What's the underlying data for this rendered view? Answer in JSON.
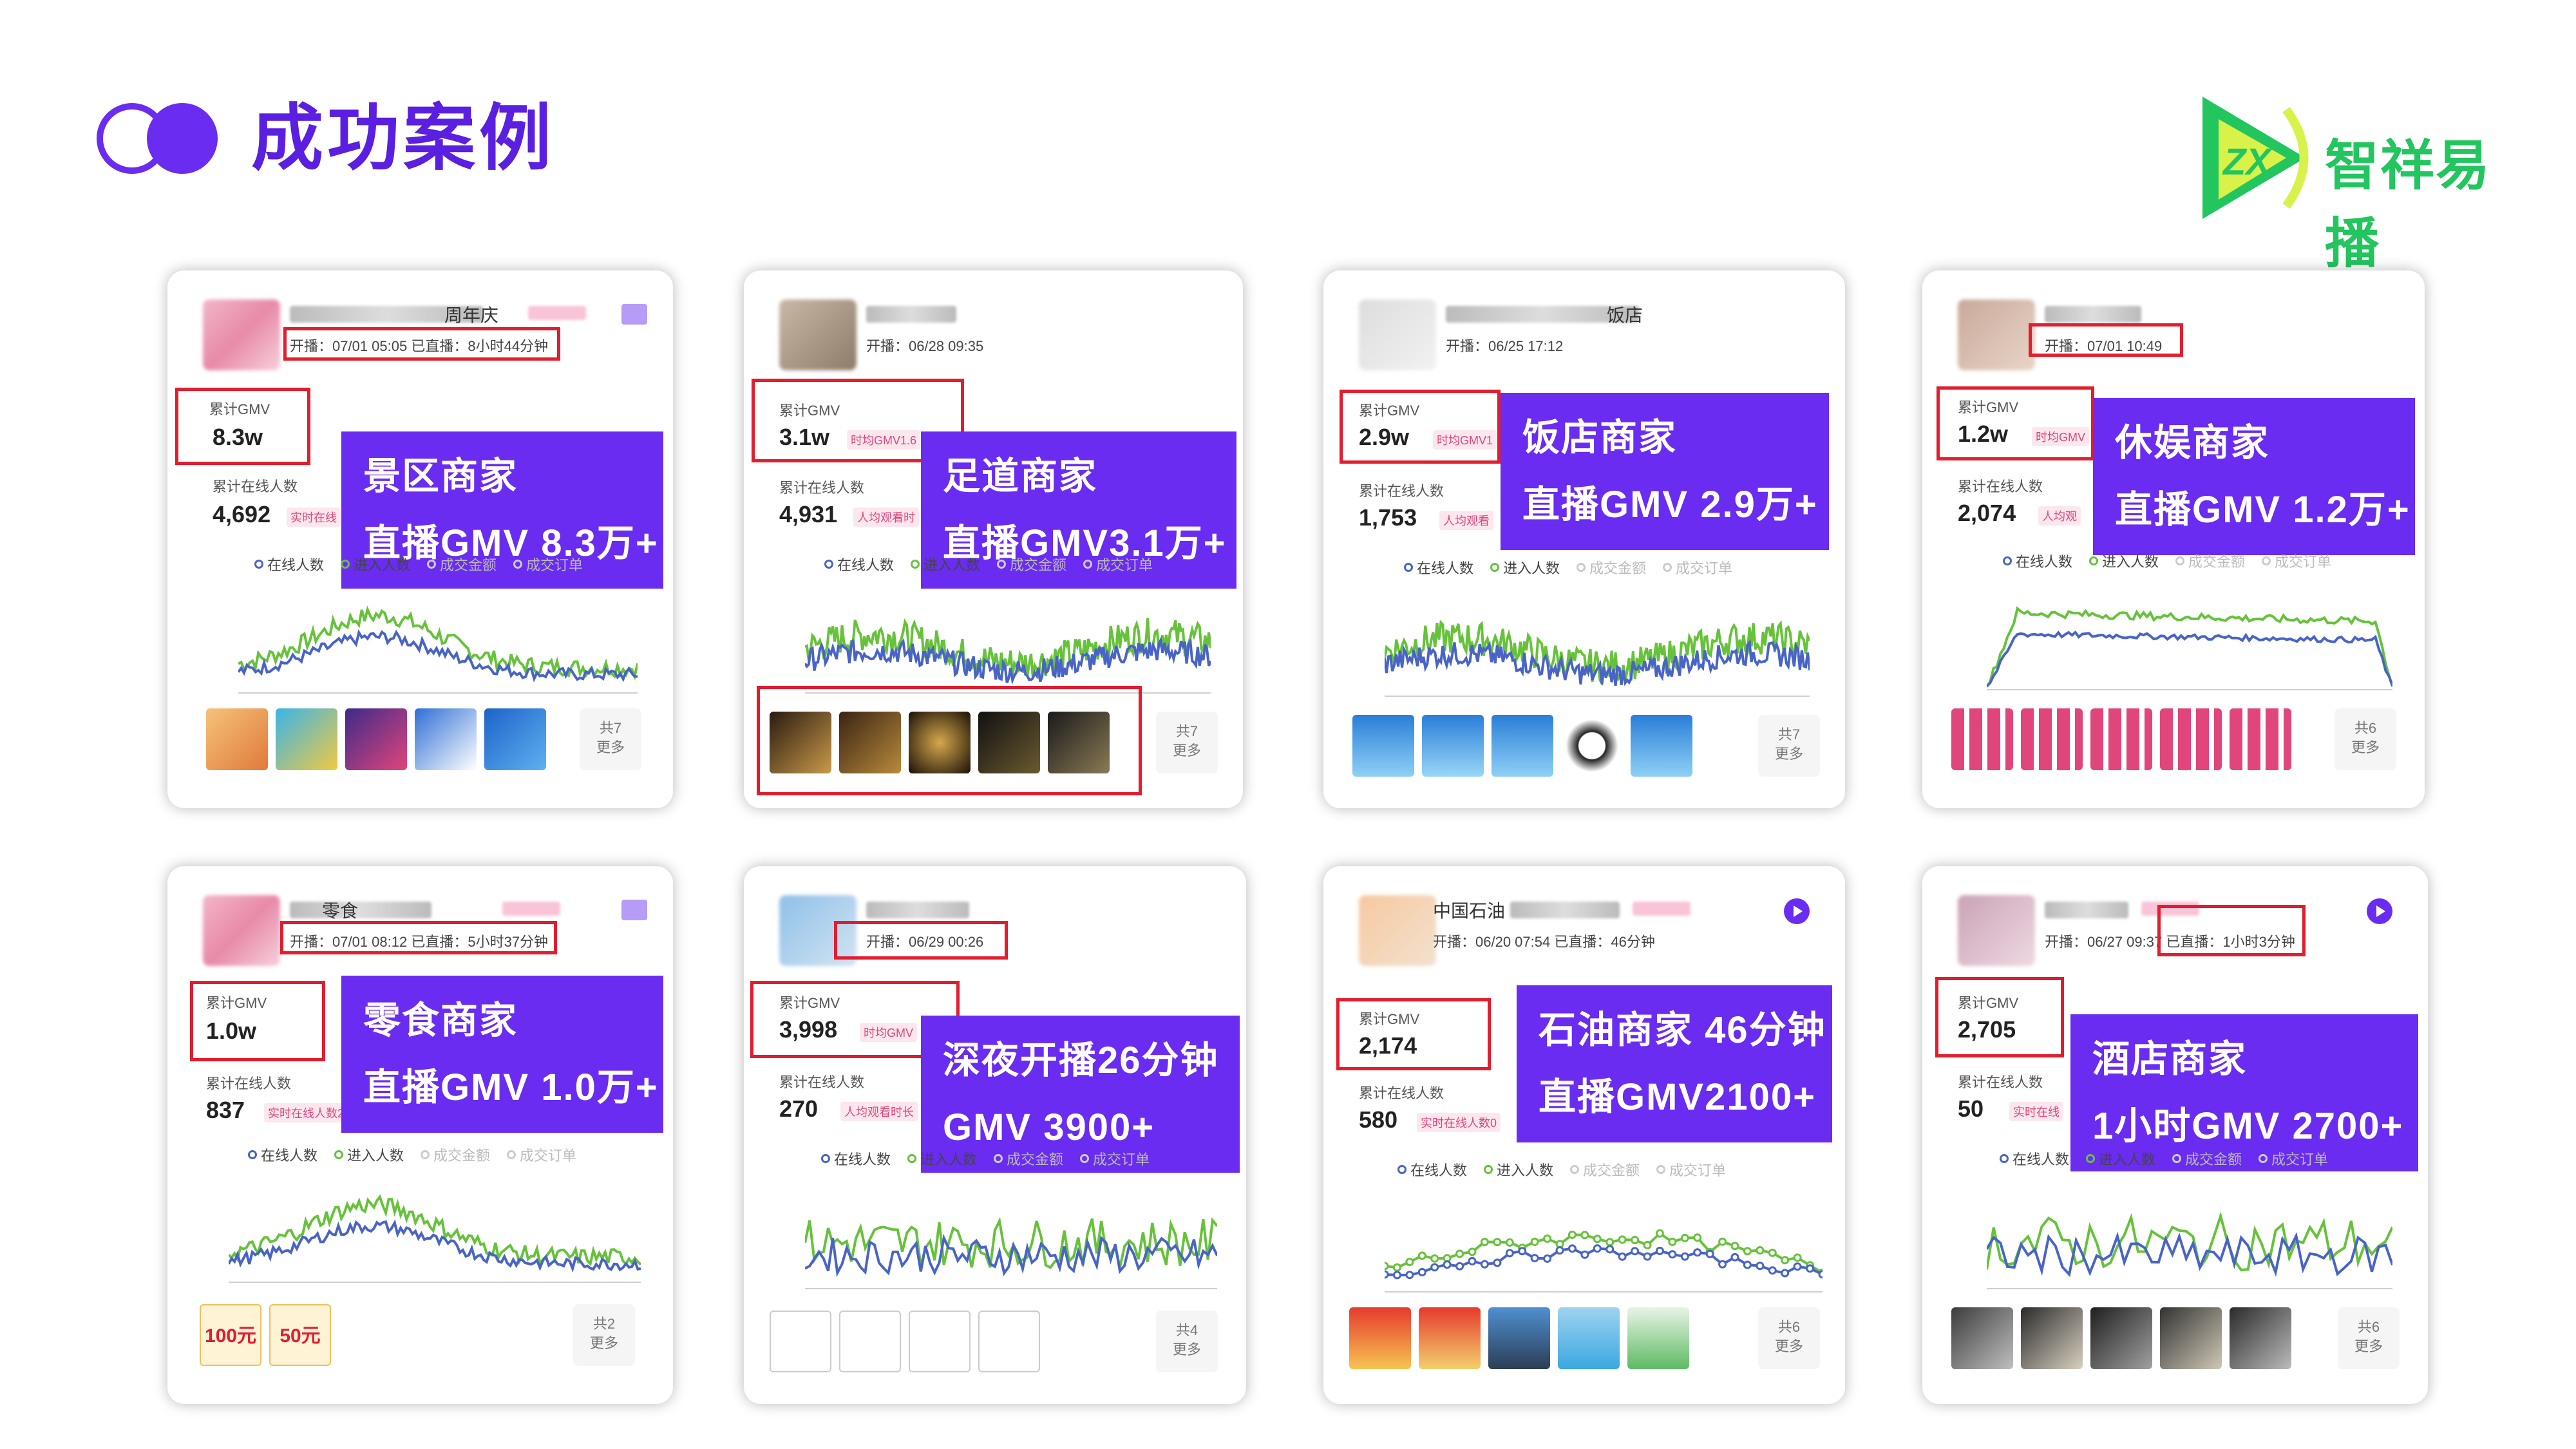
{
  "page": {
    "title": "成功案例"
  },
  "logo": {
    "mark_letters": "ZX",
    "text": "智祥易播"
  },
  "labels": {
    "start": "开播：",
    "gmv": "累计GMV",
    "online": "累计在线人数",
    "legend": [
      "在线人数",
      "进入人数",
      "成交金额",
      "成交订单"
    ]
  },
  "cards": [
    {
      "name_suffix": "周年庆",
      "start": "07/01 05:05 已直播：8小时44分钟",
      "gmv": "8.3w",
      "online": "4,692",
      "badge_gmv": "",
      "badge_online": "实时在线",
      "overlay_1": "景区商家",
      "overlay_2": "直播GMV 8.3万+",
      "more_count": "共7",
      "more_label": "更多"
    },
    {
      "name_suffix": "",
      "start": "06/28 09:35",
      "gmv": "3.1w",
      "online": "4,931",
      "badge_gmv": "时均GMV1.6",
      "badge_online": "人均观看时",
      "overlay_1": "足道商家",
      "overlay_2": "直播GMV3.1万+",
      "more_count": "共7",
      "more_label": "更多"
    },
    {
      "name_suffix": "饭店",
      "start": "06/25 17:12",
      "gmv": "2.9w",
      "online": "1,753",
      "badge_gmv": "时均GMV1",
      "badge_online": "人均观看",
      "overlay_1": "饭店商家",
      "overlay_2": "直播GMV 2.9万+",
      "more_count": "共7",
      "more_label": "更多"
    },
    {
      "name_suffix": "",
      "start": "07/01 10:49",
      "gmv": "1.2w",
      "online": "2,074",
      "badge_gmv": "时均GMV",
      "badge_online": "人均观",
      "overlay_1": "休娱商家",
      "overlay_2": "直播GMV 1.2万+",
      "more_count": "共6",
      "more_label": "更多"
    },
    {
      "name_suffix": "零食",
      "start": "07/01 08:12 已直播：5小时37分钟",
      "gmv": "1.0w",
      "online": "837",
      "badge_gmv": "",
      "badge_online": "实时在线人数2",
      "overlay_1": "零食商家",
      "overlay_2": "直播GMV 1.0万+",
      "more_count": "共2",
      "more_label": "更多",
      "coupons": [
        "100元",
        "50元"
      ]
    },
    {
      "name_suffix": "",
      "start": "06/29 00:26",
      "gmv": "3,998",
      "online": "270",
      "badge_gmv": "时均GMV",
      "badge_online": "人均观看时长",
      "overlay_1": "深夜开播26分钟",
      "overlay_2": "GMV 3900+",
      "more_count": "共4",
      "more_label": "更多"
    },
    {
      "name_prefix": "中国石油",
      "start": "06/20 07:54 已直播：46分钟",
      "gmv": "2,174",
      "online": "580",
      "badge_gmv": "",
      "badge_online": "实时在线人数0",
      "overlay_1": "石油商家 46分钟",
      "overlay_2": "直播GMV2100+",
      "more_count": "共6",
      "more_label": "更多"
    },
    {
      "name_suffix": "",
      "start": "06/27 09:37 已直播：1小时3分钟",
      "gmv": "2,705",
      "online": "50",
      "badge_gmv": "",
      "badge_online": "实时在线",
      "overlay_1": "酒店商家",
      "overlay_2": "1小时GMV 2700+",
      "more_count": "共6",
      "more_label": "更多"
    }
  ],
  "colors": {
    "accent": "#6a2cf0",
    "highlight": "#e11d2e",
    "series_online": "#4964c6",
    "series_enter": "#66c23a"
  }
}
